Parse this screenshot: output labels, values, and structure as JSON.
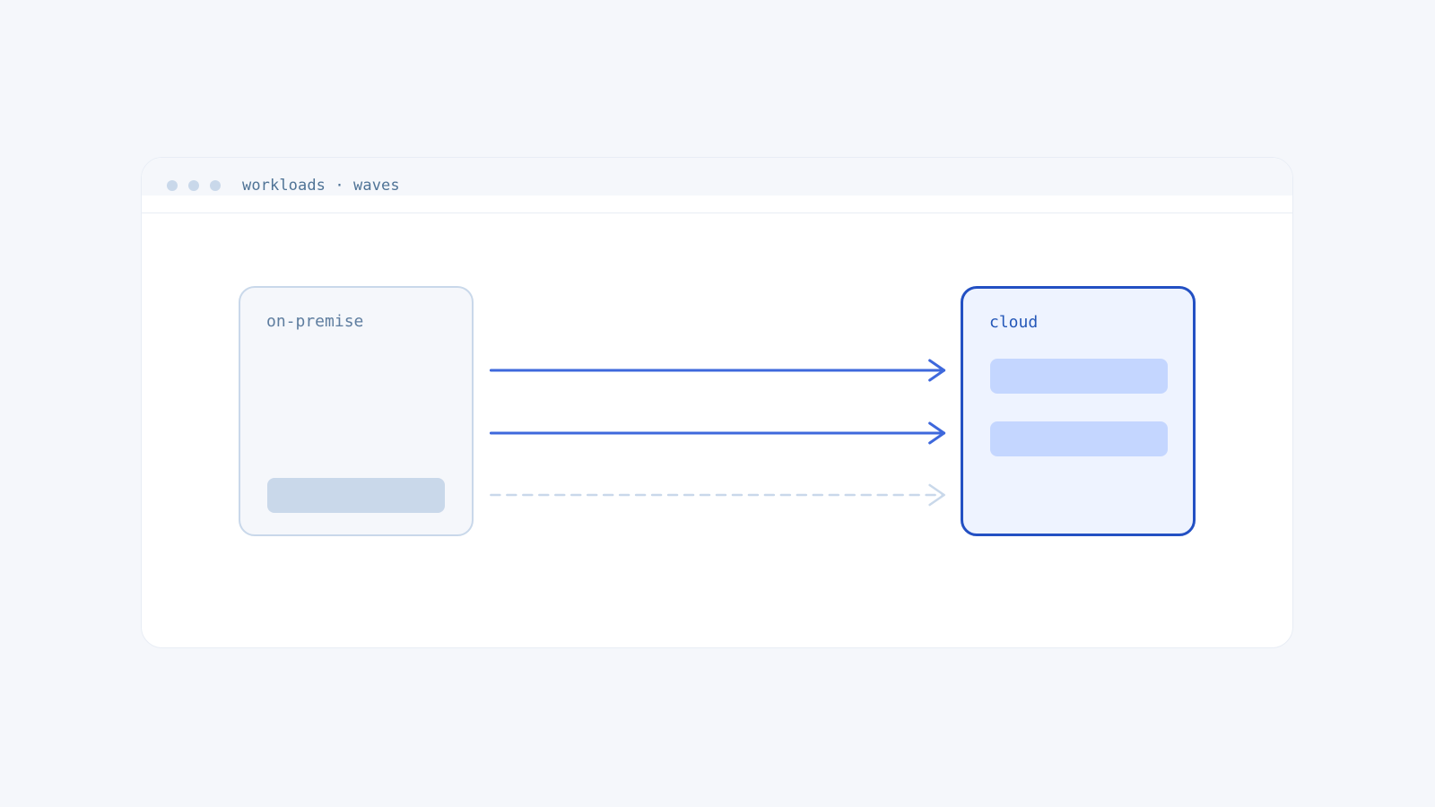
{
  "window": {
    "title": "workloads · waves"
  },
  "diagram": {
    "source": {
      "label": "on-premise",
      "remaining_items": 1
    },
    "target": {
      "label": "cloud",
      "migrated_items": 2
    },
    "arrows": [
      {
        "state": "completed",
        "style": "solid"
      },
      {
        "state": "completed",
        "style": "solid"
      },
      {
        "state": "pending",
        "style": "dashed"
      }
    ]
  },
  "colors": {
    "background": "#f5f7fb",
    "window": "#ffffff",
    "muted": "#c9d8ea",
    "accent": "#2350c3",
    "arrow_active": "#3e68dc",
    "cloud_fill": "#eef3ff",
    "cloud_item": "#c4d6ff"
  }
}
